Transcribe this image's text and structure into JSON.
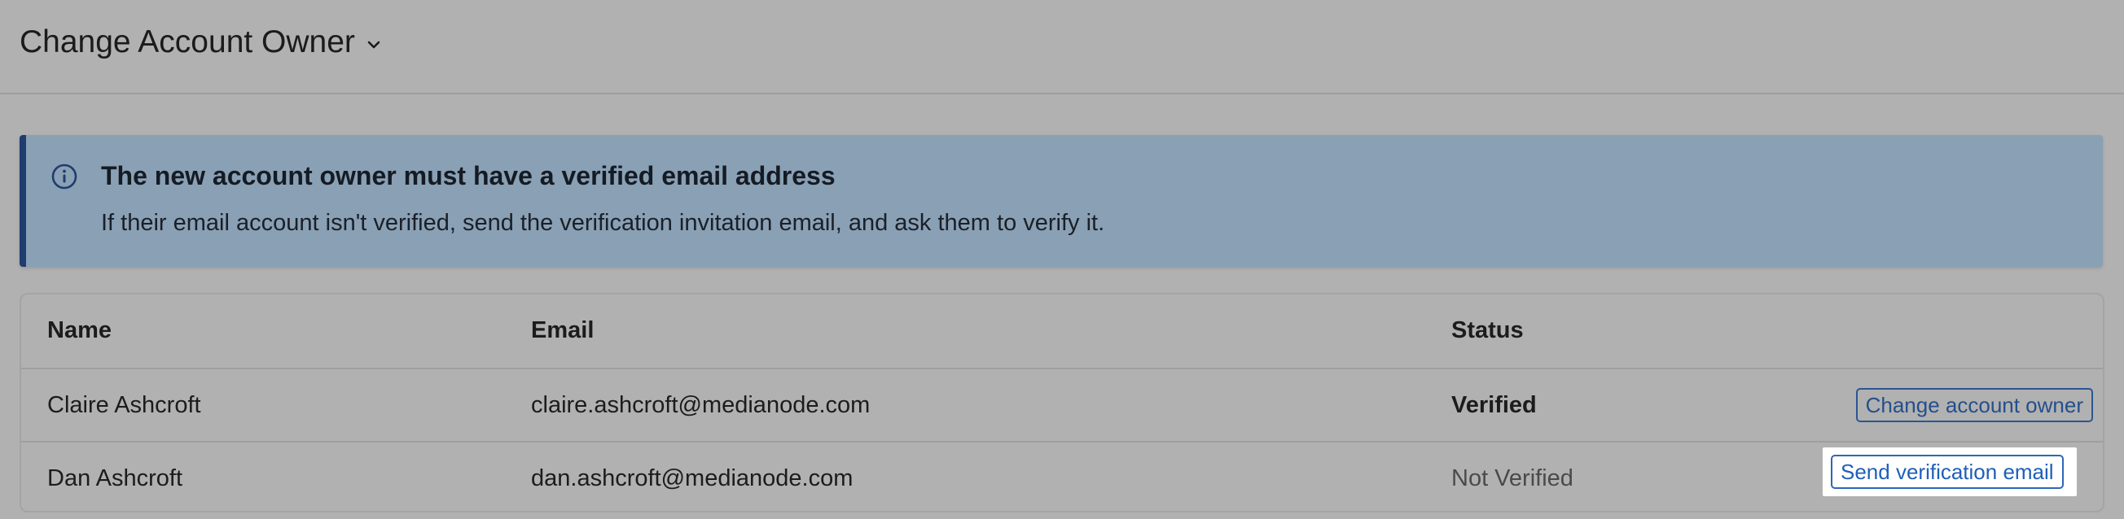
{
  "header": {
    "title": "Change Account Owner",
    "chevron_icon": "chevron-down-icon"
  },
  "banner": {
    "icon": "info-icon",
    "title": "The new account owner must have a verified email address",
    "text": "If their email account isn't verified, send the verification invitation email, and ask them to verify it.",
    "accent_color": "#1f3d6e",
    "background_color": "#8aa0b5"
  },
  "table": {
    "columns": [
      "Name",
      "Email",
      "Status"
    ],
    "rows": [
      {
        "name": "Claire Ashcroft",
        "email": "claire.ashcroft@medianode.com",
        "status": "Verified",
        "action": "Change account owner"
      },
      {
        "name": "Dan Ashcroft",
        "email": "dan.ashcroft@medianode.com",
        "status": "Not Verified",
        "action": "Send verification email"
      }
    ]
  },
  "colors": {
    "link_blue": "#244f8c",
    "page_overlay": "#b1b1b1"
  }
}
